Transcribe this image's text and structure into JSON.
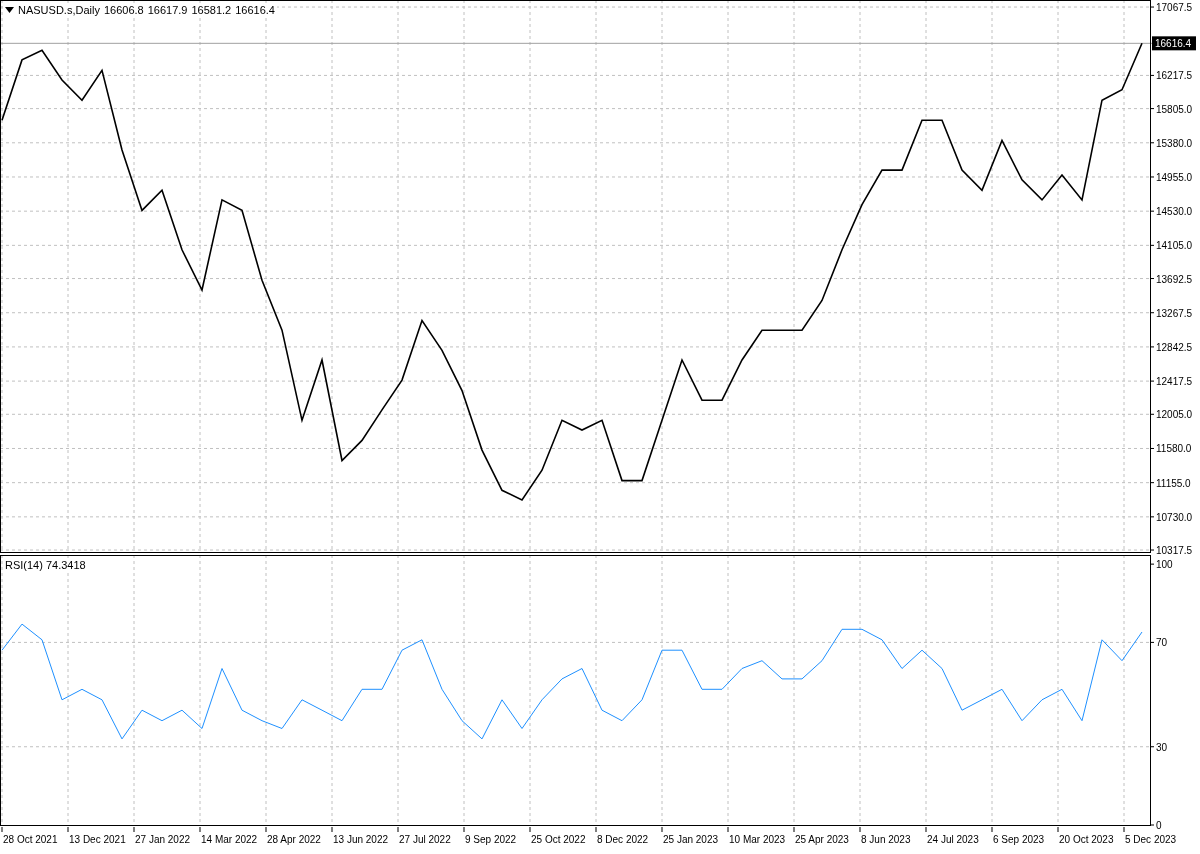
{
  "main_chart": {
    "header": {
      "symbol": "NASUSD.s,Daily",
      "ohlc": [
        "16606.8",
        "16617.9",
        "16581.2",
        "16616.4"
      ]
    },
    "chart_data": {
      "type": "line",
      "ylim": [
        10293,
        17155
      ],
      "grid": true,
      "ref_lines": [
        {
          "axis": "y",
          "value": 16616.4,
          "label": "16616.4"
        }
      ],
      "yticks": [
        {
          "value": 17067.5,
          "label": "17067.5"
        },
        {
          "value": 16217.5,
          "label": "16217.5"
        },
        {
          "value": 15805,
          "label": "15805.0"
        },
        {
          "value": 15380,
          "label": "15380.0"
        },
        {
          "value": 14955,
          "label": "14955.0"
        },
        {
          "value": 14530,
          "label": "14530.0"
        },
        {
          "value": 14105,
          "label": "14105.0"
        },
        {
          "value": 13692.5,
          "label": "13692.5"
        },
        {
          "value": 13267.5,
          "label": "13267.5"
        },
        {
          "value": 12842.5,
          "label": "12842.5"
        },
        {
          "value": 12417.5,
          "label": "12417.5"
        },
        {
          "value": 12005,
          "label": "12005.0"
        },
        {
          "value": 11580,
          "label": "11580.0"
        },
        {
          "value": 11155,
          "label": "11155.0"
        },
        {
          "value": 10730,
          "label": "10730.0"
        },
        {
          "value": 10317.5,
          "label": "10317.5"
        }
      ],
      "series": [
        {
          "color": "#000000",
          "values": [
            15660,
            16410,
            16530,
            16160,
            15910,
            16280,
            15290,
            14540,
            14790,
            14050,
            13550,
            14670,
            14540,
            13670,
            13050,
            11930,
            12680,
            11430,
            11680,
            12060,
            12430,
            13170,
            12800,
            12300,
            11560,
            11060,
            10940,
            11310,
            11930,
            11810,
            11930,
            11180,
            11180,
            11930,
            12680,
            12180,
            12180,
            12680,
            13050,
            13050,
            13050,
            13420,
            14050,
            14610,
            15040,
            15040,
            15660,
            15660,
            15040,
            14790,
            15410,
            14920,
            14670,
            14980,
            14670,
            15910,
            16040,
            16616.4
          ]
        }
      ]
    }
  },
  "rsi_panel": {
    "label": "RSI(14) 74.3418",
    "chart_data": {
      "type": "line",
      "ylim": [
        0,
        103.5
      ],
      "grid": true,
      "yticks": [
        0,
        30,
        70,
        100
      ],
      "series": [
        {
          "color": "#1e90ff",
          "values": [
            67,
            77,
            71,
            48,
            52,
            48,
            33,
            44,
            40,
            44,
            37,
            60,
            44,
            40,
            37,
            48,
            44,
            40,
            52,
            52,
            67,
            71,
            52,
            40,
            33,
            48,
            37,
            48,
            56,
            60,
            44,
            40,
            48,
            67,
            67,
            52,
            52,
            60,
            63,
            56,
            56,
            63,
            75,
            75,
            71,
            60,
            67,
            60,
            44,
            48,
            52,
            40,
            48,
            52,
            40,
            71,
            63,
            74
          ]
        }
      ]
    }
  },
  "time_axis": {
    "labels": [
      "28 Oct 2021",
      "13 Dec 2021",
      "27 Jan 2022",
      "14 Mar 2022",
      "28 Apr 2022",
      "13 Jun 2022",
      "27 Jul 2022",
      "9 Sep 2022",
      "25 Oct 2022",
      "8 Dec 2022",
      "25 Jan 2023",
      "10 Mar 2023",
      "25 Apr 2023",
      "8 Jun 2023",
      "24 Jul 2023",
      "6 Sep 2023",
      "20 Oct 2023",
      "5 Dec 2023"
    ]
  }
}
